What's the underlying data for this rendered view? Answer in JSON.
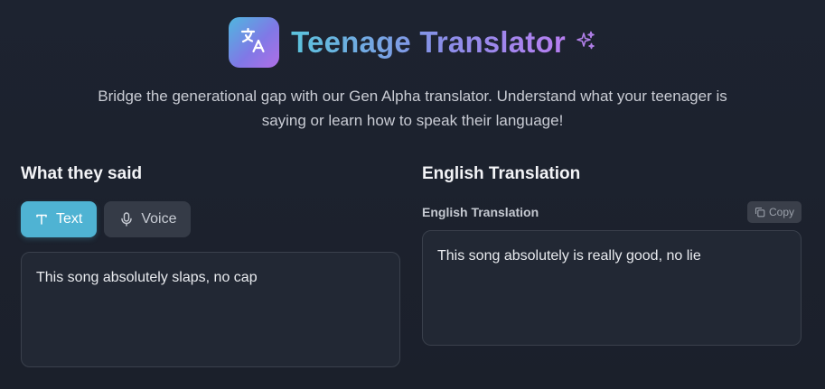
{
  "header": {
    "title": "Teenage Translator",
    "subtitle": "Bridge the generational gap with our Gen Alpha translator. Understand what your teenager is saying or learn how to speak their language!",
    "icons": {
      "logo": "translate-icon",
      "sparkle": "sparkles-icon"
    }
  },
  "input_section": {
    "title": "What they said",
    "modes": [
      {
        "label": "Text",
        "icon": "text-icon",
        "active": true
      },
      {
        "label": "Voice",
        "icon": "microphone-icon",
        "active": false
      }
    ],
    "input_value": "This song absolutely slaps, no cap"
  },
  "output_section": {
    "title": "English Translation",
    "label": "English Translation",
    "copy_label": "Copy",
    "output_value": "This song absolutely is really good, no lie"
  },
  "colors": {
    "background": "#1d2330",
    "accent": "#4fb3d3",
    "title_gradient_start": "#5bc3dc",
    "title_gradient_end": "#b77ef0"
  }
}
